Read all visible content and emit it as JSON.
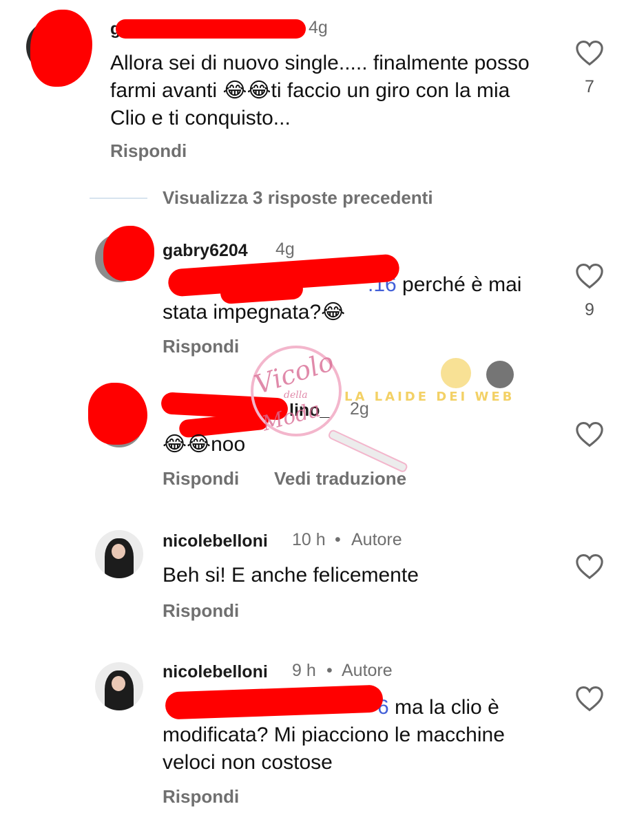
{
  "prev_replies_label": "Visualizza 3 risposte precedenti",
  "comments": [
    {
      "username_prefix": "g",
      "time": "4g",
      "text": "Allora sei di nuovo single..... finalmente posso farmi avanti 😂😂ti faccio un giro con la mia Clio e ti conquisto...",
      "reply_label": "Rispondi",
      "like_count": "7"
    },
    {
      "username": "gabry6204",
      "time": "4g",
      "mention_tail": ".16",
      "text": " perché è mai stata impegnata?😂",
      "reply_label": "Rispondi",
      "like_count": "9"
    },
    {
      "username_tail": "lino_",
      "time": "2g",
      "text": "😂😂noo",
      "reply_label": "Rispondi",
      "translate_label": "Vedi traduzione"
    },
    {
      "username": "nicolebelloni",
      "time": "10 h",
      "separator": "•",
      "badge": "Autore",
      "text": "Beh si! E anche felicemente",
      "reply_label": "Rispondi"
    },
    {
      "username": "nicolebelloni",
      "time": "9 h",
      "separator": "•",
      "badge": "Autore",
      "mention_tail": "6",
      "text": " ma la clio è modificata? Mi piacciono le macchine veloci non costose",
      "reply_label": "Rispondi"
    }
  ],
  "watermark": {
    "script_text": "Vicolo",
    "small_text": "della",
    "script_text_2": "Moda",
    "banner": "LA LAIDE DEI WEB"
  },
  "icons": {
    "like": "heart-outline-icon"
  },
  "colors": {
    "redaction": "#ff0000",
    "mention": "#4360d8",
    "secondary_text": "#707070"
  }
}
